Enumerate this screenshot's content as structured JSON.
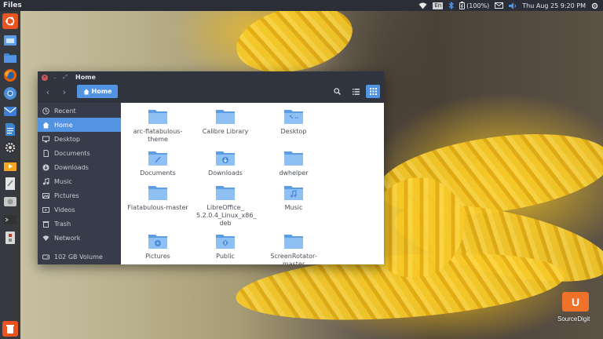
{
  "top_panel": {
    "app_name": "Files",
    "battery": "(100%)",
    "datetime": "Thu Aug 25  9:20 PM",
    "keyboard": "En"
  },
  "launcher": {
    "items": [
      {
        "name": "ubuntu-dash-icon",
        "color": "#e95420"
      },
      {
        "name": "files-icon",
        "color": "#5294e2"
      },
      {
        "name": "files-home-icon",
        "color": "#3b86d8"
      },
      {
        "name": "firefox-icon",
        "color": "#e66000"
      },
      {
        "name": "chromium-icon",
        "color": "#4a90d9"
      },
      {
        "name": "thunderbird-icon",
        "color": "#3d7fd6"
      },
      {
        "name": "libreoffice-writer-icon",
        "color": "#3a85d0"
      },
      {
        "name": "system-settings-icon",
        "color": "#8a8a8a"
      },
      {
        "name": "video-player-icon",
        "color": "#f5a623"
      },
      {
        "name": "text-editor-icon",
        "color": "#9a9a9a"
      },
      {
        "name": "disks-icon",
        "color": "#b0b0b0"
      },
      {
        "name": "terminal-icon",
        "color": "#333333"
      },
      {
        "name": "software-updater-icon",
        "color": "#c8c8c8"
      },
      {
        "name": "trash-icon",
        "color": "#e95420"
      }
    ]
  },
  "window": {
    "title": "Home",
    "path_button": "Home",
    "accent": "#5294e2"
  },
  "sidebar": {
    "items": [
      {
        "label": "Recent",
        "icon": "clock-icon"
      },
      {
        "label": "Home",
        "icon": "home-icon",
        "active": true
      },
      {
        "label": "Desktop",
        "icon": "desktop-icon"
      },
      {
        "label": "Documents",
        "icon": "document-icon"
      },
      {
        "label": "Downloads",
        "icon": "download-icon"
      },
      {
        "label": "Music",
        "icon": "music-icon"
      },
      {
        "label": "Pictures",
        "icon": "picture-icon"
      },
      {
        "label": "Videos",
        "icon": "video-icon"
      },
      {
        "label": "Trash",
        "icon": "trash-icon"
      },
      {
        "label": "Network",
        "icon": "network-icon"
      }
    ],
    "volume": {
      "label": "102 GB Volume",
      "icon": "drive-icon"
    }
  },
  "files": [
    {
      "label": "arc-flatabulous-theme",
      "emblem": ""
    },
    {
      "label": "Calibre Library",
      "emblem": ""
    },
    {
      "label": "Desktop",
      "emblem": "desktop"
    },
    {
      "label": "Documents",
      "emblem": "document"
    },
    {
      "label": "Downloads",
      "emblem": "download"
    },
    {
      "label": "dwhelper",
      "emblem": ""
    },
    {
      "label": "Flatabulous-master",
      "emblem": ""
    },
    {
      "label": "LibreOffice_ 5.2.0.4_Linux_x86_ deb",
      "emblem": ""
    },
    {
      "label": "Music",
      "emblem": "music"
    },
    {
      "label": "Pictures",
      "emblem": "picture"
    },
    {
      "label": "Public",
      "emblem": "public"
    },
    {
      "label": "ScreenRotator-master",
      "emblem": ""
    }
  ],
  "watermark": {
    "logo_letter": "U",
    "text": "SourceDigit"
  }
}
